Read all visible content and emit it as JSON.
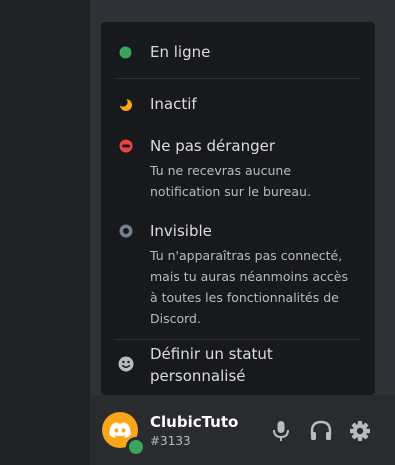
{
  "status_menu": {
    "items": [
      {
        "label": "En ligne",
        "color": "#3ba55d",
        "icon": "online-dot-icon"
      },
      {
        "label": "Inactif",
        "color": "#faa61a",
        "icon": "idle-moon-icon"
      },
      {
        "label": "Ne pas déranger",
        "color": "#ed4245",
        "icon": "dnd-icon",
        "description": [
          "Tu ne recevras aucune",
          "notification sur le bureau."
        ]
      },
      {
        "label": "Invisible",
        "color": "#747f8d",
        "icon": "invisible-ring-icon",
        "description": [
          "Tu n'apparaîtras pas connecté,",
          "mais tu auras néanmoins accès",
          "à toutes les fonctionnalités de",
          "Discord."
        ]
      },
      {
        "label_lines": [
          "Définir un statut",
          "personnalisé"
        ],
        "icon": "smiley-icon"
      }
    ]
  },
  "user": {
    "username": "ClubicTuto",
    "discriminator": "#3133",
    "avatar_color": "#faa61a",
    "status_color": "#3ba55d"
  },
  "controls": {
    "icons": [
      "microphone-icon",
      "headphones-icon",
      "gear-icon"
    ]
  }
}
